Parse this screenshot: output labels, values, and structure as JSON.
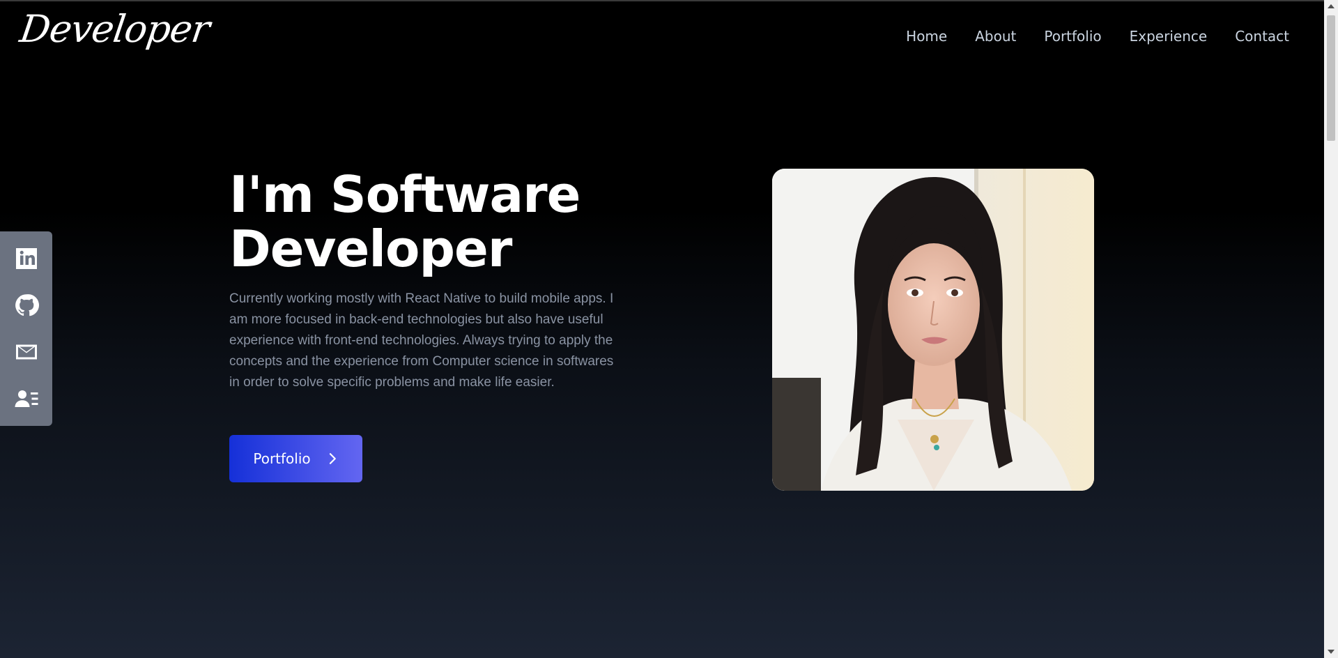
{
  "header": {
    "logo": "Developer",
    "nav": [
      "Home",
      "About",
      "Portfolio",
      "Experience",
      "Contact"
    ]
  },
  "social": [
    {
      "icon": "linkedin-icon"
    },
    {
      "icon": "github-icon"
    },
    {
      "icon": "mail-icon"
    },
    {
      "icon": "resume-icon"
    }
  ],
  "hero": {
    "title_line1": "I'm Software",
    "title_line2": "Developer",
    "description": "Currently working mostly with React Native to build mobile apps. I am more focused in back-end technologies but also have useful experience with front-end technologies. Always trying to apply the concepts and the experience from Computer science in softwares in order to solve specific problems and make life easier.",
    "cta_label": "Portfolio"
  },
  "colors": {
    "background_top": "#000000",
    "background_bottom": "#1c2433",
    "cta_gradient_start": "#1530d8",
    "cta_gradient_end": "#6366f1",
    "sidebar": "#6b7280"
  }
}
